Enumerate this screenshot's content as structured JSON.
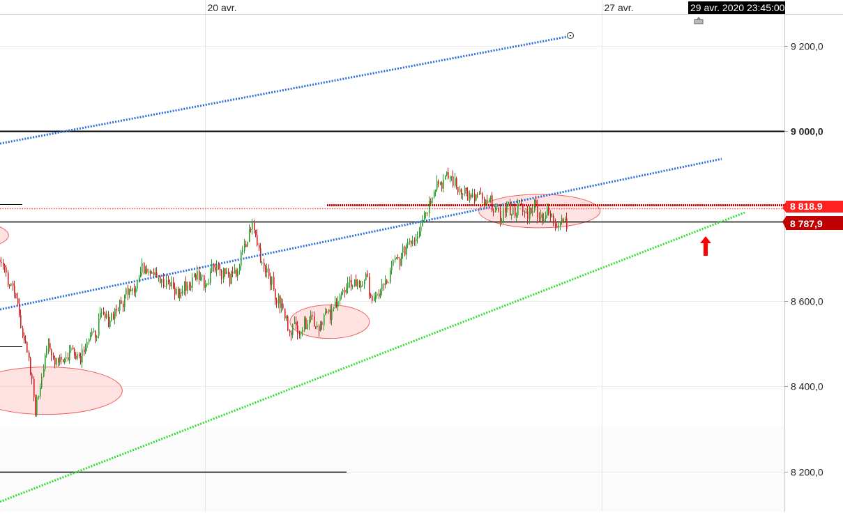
{
  "chart_data": {
    "type": "line",
    "title": "",
    "xlabel": "",
    "ylabel": "",
    "ylim": [
      8140,
      9280
    ],
    "y_ticks": [
      {
        "value": 9200,
        "label": "9 200,0"
      },
      {
        "value": 9000,
        "label": "9 000,0"
      },
      {
        "value": 8600,
        "label": "8 600,0"
      },
      {
        "value": 8400,
        "label": "8 400,0"
      },
      {
        "value": 8200,
        "label": "8 200,0"
      }
    ],
    "x_labels": [
      {
        "date": "20 avr.",
        "label": "20 avr."
      },
      {
        "date": "27 avr.",
        "label": "27 avr."
      }
    ],
    "cursor_label": "29 avr. 2020 23:45:00",
    "price_labels": [
      {
        "value": 8818.9,
        "label": "8 818.9",
        "color": "#ff2020"
      },
      {
        "value": 8787.9,
        "label": "8 787,9",
        "color": "#c00000"
      }
    ],
    "horizontal_levels": [
      {
        "value": 9000,
        "color": "#000000"
      },
      {
        "value": 8787.9,
        "color": "#000000"
      },
      {
        "value": 8200,
        "color": "#000000"
      },
      {
        "value": 8818.9,
        "color": "#ff4040"
      },
      {
        "value": 8826,
        "color": "#d40000"
      }
    ],
    "trendlines": [
      {
        "name": "blue-upper",
        "color": "#2a6fdb",
        "from": [
          8.5,
          8975
        ],
        "to": [
          23.0,
          9215
        ]
      },
      {
        "name": "blue-lower",
        "color": "#2a6fdb",
        "from": [
          8.5,
          8578
        ],
        "to": [
          26.8,
          8930
        ]
      },
      {
        "name": "green-support",
        "color": "#2ee02e",
        "from": [
          8.5,
          8142
        ],
        "to": [
          27.3,
          8810
        ]
      }
    ],
    "highlight_zones": [
      {
        "center": [
          11.7,
          8983
        ],
        "color": "#ff8080"
      },
      {
        "center": [
          14.1,
          8755
        ],
        "color": "#ff8080"
      },
      {
        "center": [
          17.2,
          8390
        ],
        "color": "#ff8080"
      },
      {
        "center": [
          22.2,
          8552
        ],
        "color": "#ff8080"
      },
      {
        "center": [
          25.9,
          8812
        ],
        "color": "#ff8080"
      }
    ],
    "arrow_marker": {
      "x": 26.2,
      "y": 8700,
      "direction": "up",
      "color": "#ff0000"
    },
    "series": [
      {
        "color_up": "#2aa02a",
        "color_down": "#d42020",
        "x": [
          8.5,
          8.7,
          8.9,
          9.1,
          9.3,
          9.5,
          9.7,
          9.9,
          10.1,
          10.3,
          10.5,
          10.7,
          10.85,
          11.0,
          11.2,
          11.4,
          11.6,
          11.8,
          12.0,
          12.2,
          12.4,
          12.6,
          12.8,
          13.0,
          13.2,
          13.4,
          13.6,
          13.8,
          14.0,
          14.2,
          14.4,
          14.6,
          14.8,
          15.0,
          15.2,
          15.4,
          15.6,
          15.8,
          16.0,
          16.2,
          16.4,
          16.6,
          16.8,
          17.0,
          17.2,
          17.4,
          17.6,
          17.8,
          18.0,
          18.2,
          18.4,
          18.6,
          18.8,
          19.0,
          19.2,
          19.4,
          19.6,
          19.8,
          20.0,
          20.2,
          20.4,
          20.6,
          20.8,
          21.0,
          21.2,
          21.4,
          21.6,
          21.8,
          22.0,
          22.2,
          22.4,
          22.6,
          22.8,
          23.0,
          23.2,
          23.4,
          23.6,
          23.8,
          24.0,
          24.2,
          24.4,
          24.6,
          24.8,
          25.0,
          25.2,
          25.4,
          25.6,
          25.8,
          26.0,
          26.2,
          26.4
        ],
        "values": [
          8590,
          8570,
          8520,
          8550,
          8600,
          8530,
          8540,
          8530,
          8570,
          8680,
          8690,
          8620,
          8660,
          8620,
          8710,
          8800,
          8920,
          8900,
          8920,
          8920,
          8880,
          8930,
          8820,
          8760,
          8720,
          8740,
          8800,
          8780,
          8800,
          8740,
          8770,
          8720,
          8730,
          8820,
          8790,
          8730,
          8740,
          8720,
          8650,
          8680,
          8690,
          8630,
          8520,
          8350,
          8490,
          8460,
          8480,
          8480,
          8520,
          8560,
          8570,
          8620,
          8650,
          8690,
          8650,
          8630,
          8620,
          8660,
          8650,
          8690,
          8650,
          8680,
          8780,
          8700,
          8630,
          8560,
          8530,
          8560,
          8550,
          8570,
          8620,
          8640,
          8650,
          8600,
          8650,
          8700,
          8740,
          8780,
          8860,
          8890,
          8880,
          8850,
          8840,
          8830,
          8800,
          8820,
          8810,
          8820,
          8800,
          8790,
          8790
        ]
      }
    ]
  }
}
